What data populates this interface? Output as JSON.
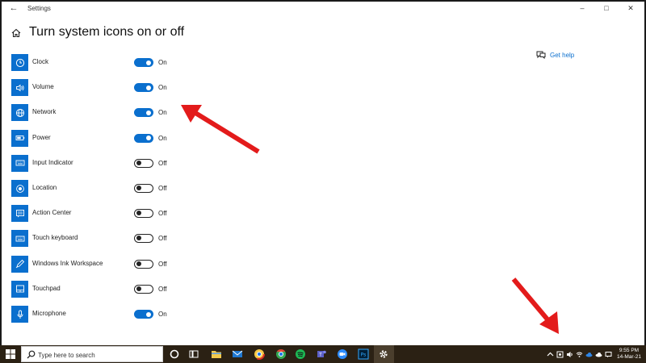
{
  "window": {
    "app_title": "Settings",
    "back_glyph": "←",
    "controls": {
      "minimize": "–",
      "maximize": "□",
      "close": "✕"
    }
  },
  "page": {
    "title": "Turn system icons on or off"
  },
  "help": {
    "label": "Get help"
  },
  "settings": [
    {
      "label": "Clock",
      "state": "On",
      "on": true,
      "icon": "clock-icon"
    },
    {
      "label": "Volume",
      "state": "On",
      "on": true,
      "icon": "volume-icon"
    },
    {
      "label": "Network",
      "state": "On",
      "on": true,
      "icon": "globe-icon"
    },
    {
      "label": "Power",
      "state": "On",
      "on": true,
      "icon": "battery-icon"
    },
    {
      "label": "Input Indicator",
      "state": "Off",
      "on": false,
      "icon": "keyboard-icon"
    },
    {
      "label": "Location",
      "state": "Off",
      "on": false,
      "icon": "location-icon"
    },
    {
      "label": "Action Center",
      "state": "Off",
      "on": false,
      "icon": "message-icon"
    },
    {
      "label": "Touch keyboard",
      "state": "Off",
      "on": false,
      "icon": "keyboard-icon"
    },
    {
      "label": "Windows Ink Workspace",
      "state": "Off",
      "on": false,
      "icon": "pen-icon"
    },
    {
      "label": "Touchpad",
      "state": "Off",
      "on": false,
      "icon": "touchpad-icon"
    },
    {
      "label": "Microphone",
      "state": "On",
      "on": true,
      "icon": "microphone-icon"
    }
  ],
  "taskbar": {
    "search_placeholder": "Type here to search",
    "apps": [
      "cortana-icon",
      "task-view-icon",
      "file-explorer-icon",
      "mail-icon",
      "chrome-canary-icon",
      "chrome-icon",
      "spotify-icon",
      "teams-icon",
      "zoom-icon",
      "photoshop-icon",
      "settings-gear-icon"
    ],
    "clock_time": "9:55 PM",
    "clock_date": "14-Mar-21"
  },
  "colors": {
    "accent": "#0a6fce",
    "taskbar": "#2b2114",
    "arrow": "#e31b1b"
  }
}
